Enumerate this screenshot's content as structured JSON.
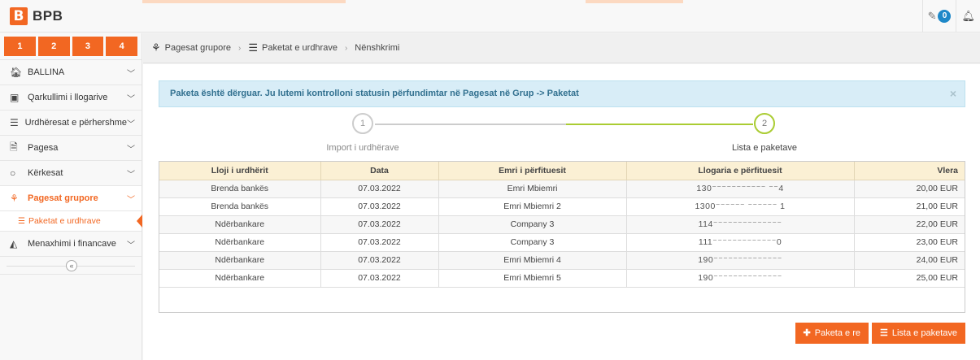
{
  "app": {
    "logo_mark": "B",
    "logo_text": "BPB"
  },
  "topbar": {
    "edit_icon": "edit-icon",
    "notification_count": "0",
    "bell_icon": "bell-icon"
  },
  "shortcuts": [
    "1",
    "2",
    "3",
    "4"
  ],
  "sidebar": {
    "items": [
      {
        "label": "BALLINA",
        "icon": "home-icon"
      },
      {
        "label": "Qarkullimi i llogarive",
        "icon": "money-icon"
      },
      {
        "label": "Urdhëresat e përhershme",
        "icon": "list-icon"
      },
      {
        "label": "Pagesa",
        "icon": "document-icon"
      },
      {
        "label": "Kërkesat",
        "icon": "circle-icon"
      },
      {
        "label": "Pagesat grupore",
        "icon": "group-payments-icon",
        "active": true
      },
      {
        "label": "Menaxhimi i financave",
        "icon": "chart-icon"
      }
    ],
    "sub_item": "Paketat e urdhrave",
    "collapse_glyph": "«"
  },
  "breadcrumb": [
    "Pagesat grupore",
    "Paketat e urdhrave",
    "Nënshkrimi"
  ],
  "alert": {
    "message": "Paketa është dërguar. Ju lutemi kontrolloni statusin përfundimtar në Pagesat në Grup -> Paketat",
    "close": "×"
  },
  "wizard": {
    "steps": [
      {
        "number": "1",
        "label": "Import i urdhërave"
      },
      {
        "number": "2",
        "label": "Lista e paketave"
      }
    ]
  },
  "table": {
    "columns": [
      "Lloji i urdhërit",
      "Data",
      "Emri i përfituesit",
      "Llogaria e përfituesit",
      "Vlera"
    ],
    "rows": [
      [
        "Brenda bankës",
        "07.03.2022",
        "Emri Mbiemri",
        "130⁻⁻⁻⁻⁻⁻⁻⁻⁻⁻⁻ ⁻⁻4",
        "20,00 EUR"
      ],
      [
        "Brenda bankës",
        "07.03.2022",
        "Emri Mbiemri 2",
        "1300⁻⁻⁻⁻⁻⁻ ⁻⁻⁻⁻⁻⁻ 1",
        "21,00 EUR"
      ],
      [
        "Ndërbankare",
        "07.03.2022",
        "Company 3",
        "114⁻⁻⁻⁻⁻⁻⁻⁻⁻⁻⁻⁻⁻⁻",
        "22,00 EUR"
      ],
      [
        "Ndërbankare",
        "07.03.2022",
        "Company 3",
        "111⁻⁻⁻⁻⁻⁻⁻⁻⁻⁻⁻⁻⁻0",
        "23,00 EUR"
      ],
      [
        "Ndërbankare",
        "07.03.2022",
        "Emri Mbiemri 4",
        "190⁻⁻⁻⁻⁻⁻⁻⁻⁻⁻⁻⁻⁻⁻",
        "24,00 EUR"
      ],
      [
        "Ndërbankare",
        "07.03.2022",
        "Emri Mbiemri 5",
        "190⁻⁻⁻⁻⁻⁻⁻⁻⁻⁻⁻⁻⁻⁻",
        "25,00 EUR"
      ]
    ]
  },
  "actions": {
    "new_package": "Paketa e re",
    "package_list": "Lista e paketave"
  }
}
